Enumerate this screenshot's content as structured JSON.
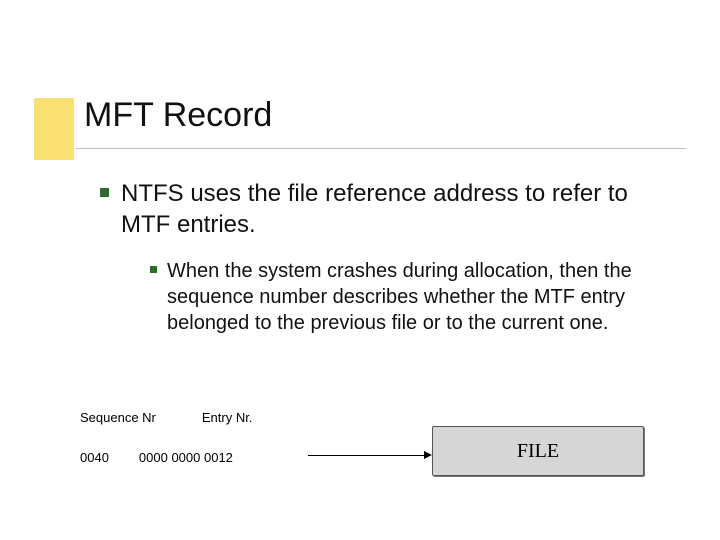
{
  "title": "MFT Record",
  "bullet1": "NTFS uses the file reference address to refer to MTF entries.",
  "bullet2": "When the system crashes during allocation, then the sequence number describes whether the MTF entry belonged to the previous file or to the current one.",
  "diagram": {
    "seq_label": "Sequence Nr",
    "entry_label": "Entry Nr.",
    "seq_value": "0040",
    "entry_value": "0000 0000 0012",
    "file_label": "FILE"
  }
}
